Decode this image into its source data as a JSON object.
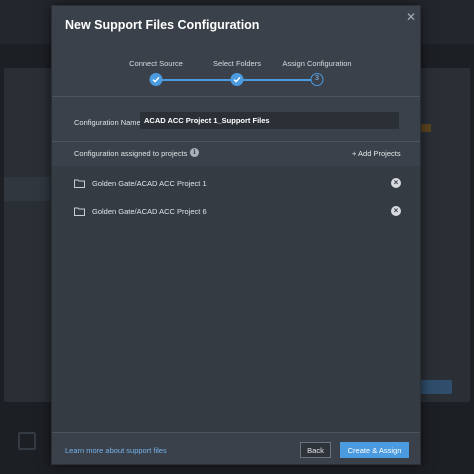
{
  "modal": {
    "title": "New Support Files Configuration",
    "close_icon": "close-icon"
  },
  "stepper": {
    "steps": [
      {
        "label": "Connect Source",
        "status": "done"
      },
      {
        "label": "Select Folders",
        "status": "done"
      },
      {
        "label": "Assign Configuration",
        "status": "current",
        "number": "3"
      }
    ],
    "accent_color": "#4a9be0"
  },
  "config": {
    "label": "Configuration Name",
    "value": "ACAD ACC Project 1_Support Files"
  },
  "assigned": {
    "title": "Configuration assigned to projects",
    "info_icon": "info-icon",
    "add_label": "+ Add Projects",
    "projects": [
      {
        "name": "Golden Gate/ACAD ACC Project 1",
        "icon": "folder-icon"
      },
      {
        "name": "Golden Gate/ACAD ACC Project 6",
        "icon": "folder-icon"
      }
    ]
  },
  "footer": {
    "learn_link": "Learn more about support files",
    "back_label": "Back",
    "primary_label": "Create & Assign"
  }
}
